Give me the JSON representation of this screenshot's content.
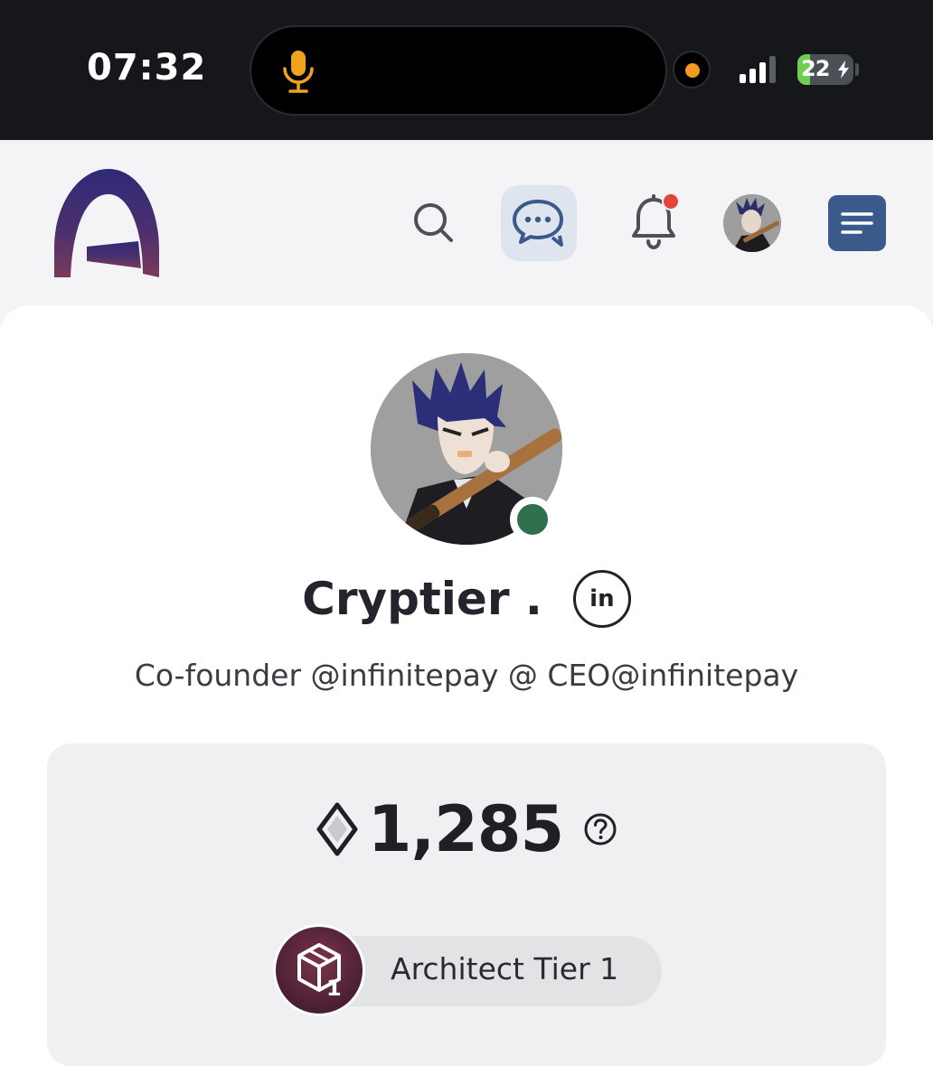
{
  "status_bar": {
    "time": "07:32",
    "battery_level": "22",
    "battery_percent": 22,
    "mic_icon": "microphone-icon",
    "signal_icon": "cellular-signal-icon"
  },
  "header": {
    "logo": "app-logo",
    "icons": [
      "search-icon",
      "chat-icon",
      "bell-icon",
      "avatar",
      "menu-icon"
    ],
    "notification_color": "#e14438",
    "menu_bg_color": "#3a5a8c"
  },
  "profile": {
    "name": "Cryptier .",
    "linkedin_label": "in",
    "bio": "Co-founder @infinitepay @ CEO@infinitepay",
    "online_color": "#2e6f4e"
  },
  "points": {
    "value": "1,285",
    "icon": "diamond-icon",
    "help_icon": "question-circle-icon"
  },
  "tier": {
    "label": "Architect Tier 1",
    "badge_number": "1",
    "badge_icon": "cube-icon"
  }
}
